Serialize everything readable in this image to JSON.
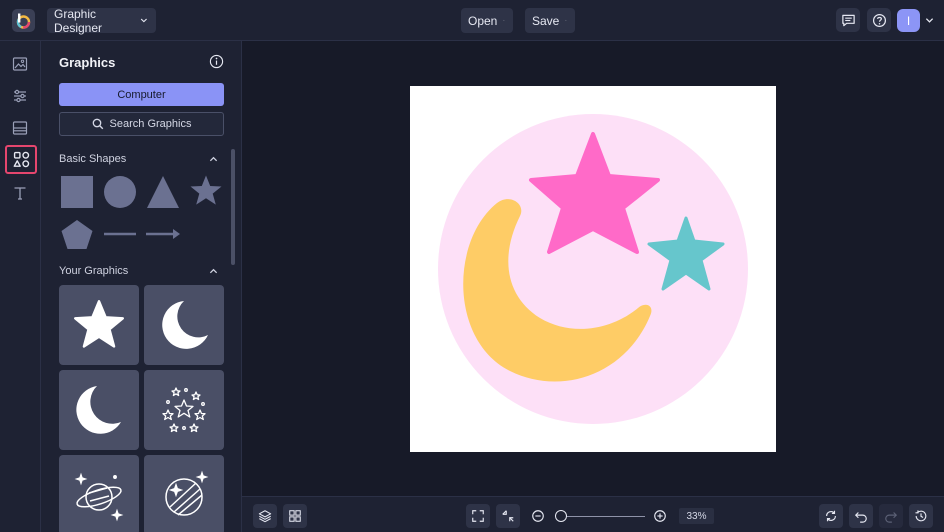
{
  "topbar": {
    "app_menu_label": "Graphic Designer",
    "open_label": "Open",
    "save_label": "Save",
    "avatar_initial": "I"
  },
  "rail": {
    "items": [
      "image-icon",
      "adjustments-icon",
      "layout-icon",
      "graphics-icon",
      "text-icon"
    ],
    "active": "graphics-icon"
  },
  "panel": {
    "title": "Graphics",
    "computer_button": "Computer",
    "search_button": "Search Graphics",
    "basic_shapes_title": "Basic Shapes",
    "basic_shapes": [
      "square",
      "circle",
      "triangle",
      "star",
      "pentagon",
      "line",
      "arrow"
    ],
    "your_graphics_title": "Your Graphics",
    "your_graphics": [
      "star",
      "crescent-moon",
      "crescent-moon",
      "star-cluster",
      "planet",
      "planet-stars"
    ]
  },
  "canvas": {
    "background": "#ffffff",
    "graphic": {
      "circle_color": "#fde0f7",
      "moon_color": "#fecc66",
      "big_star_color": "#ff6ac8",
      "small_star_color": "#66c6cc"
    }
  },
  "bottombar": {
    "zoom_value": "33%"
  },
  "colors": {
    "accent": "#8a93f6",
    "highlight": "#e5466e",
    "chrome": "#1e2233",
    "workspace": "#171a28"
  }
}
